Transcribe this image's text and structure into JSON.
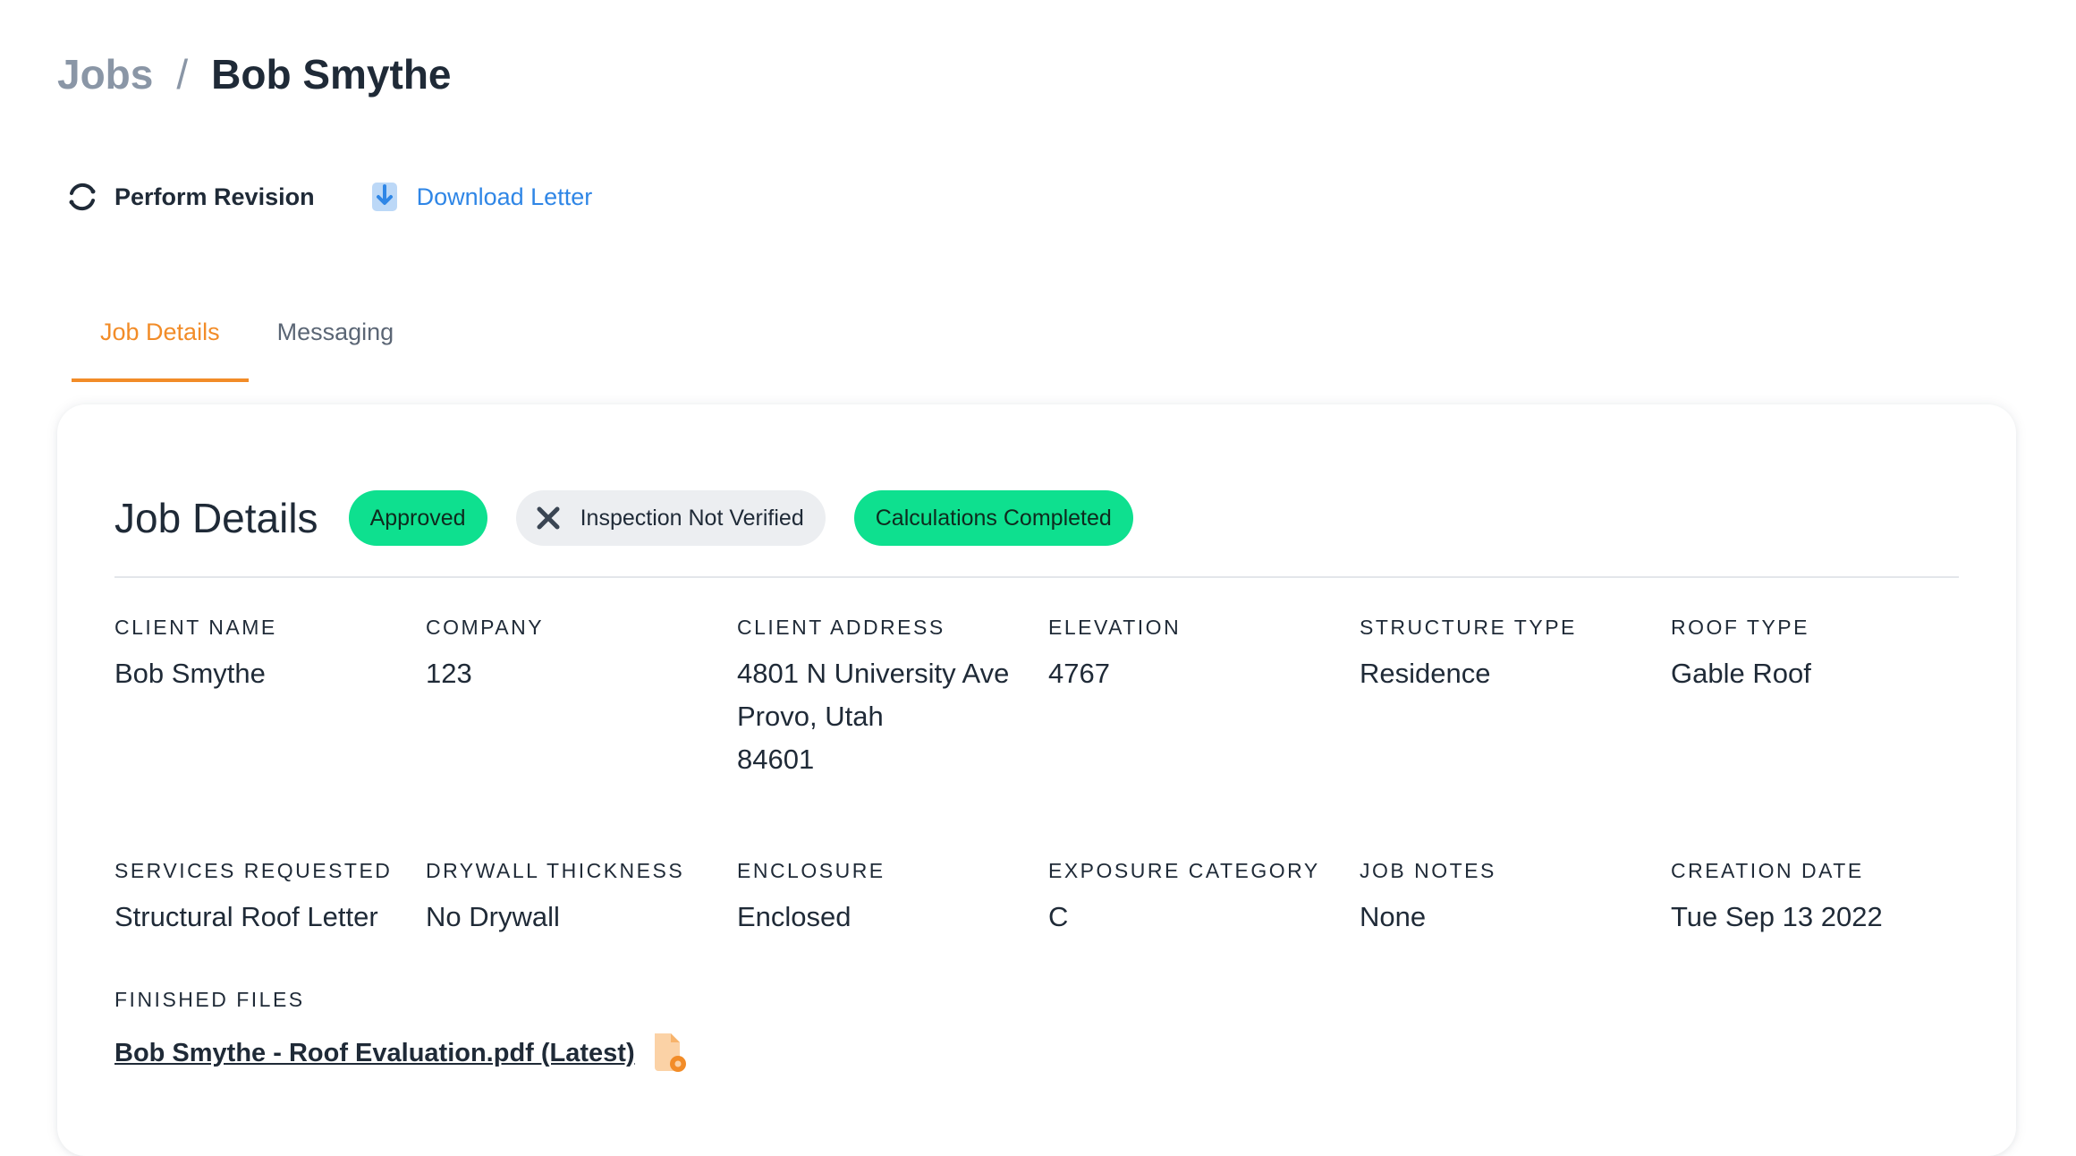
{
  "breadcrumb": {
    "parent": "Jobs",
    "separator": "/",
    "current": "Bob Smythe"
  },
  "toolbar": {
    "revision": {
      "label": "Perform Revision",
      "icon": "refresh-icon"
    },
    "download": {
      "label": "Download Letter",
      "icon": "download-icon"
    }
  },
  "tabs": [
    {
      "label": "Job Details",
      "active": true
    },
    {
      "label": "Messaging",
      "active": false
    }
  ],
  "card": {
    "title": "Job Details",
    "badges": [
      {
        "label": "Approved",
        "style": "green"
      },
      {
        "label": "Inspection Not Verified",
        "style": "gray",
        "icon": "x-icon"
      },
      {
        "label": "Calculations Completed",
        "style": "green"
      }
    ],
    "fields_row1": [
      {
        "label": "Client Name",
        "value": "Bob Smythe"
      },
      {
        "label": "Company",
        "value": "123"
      },
      {
        "label": "Client Address",
        "lines": [
          "4801 N University Ave",
          "Provo, Utah",
          "84601"
        ]
      },
      {
        "label": "Elevation",
        "value": "4767"
      },
      {
        "label": "Structure Type",
        "value": "Residence"
      },
      {
        "label": "Roof Type",
        "value": "Gable Roof"
      }
    ],
    "fields_row2": [
      {
        "label": "Services Requested",
        "value": "Structural Roof Letter"
      },
      {
        "label": "Drywall Thickness",
        "value": "No Drywall"
      },
      {
        "label": "Enclosure",
        "value": "Enclosed"
      },
      {
        "label": "Exposure Category",
        "value": "C"
      },
      {
        "label": "Job Notes",
        "value": "None"
      },
      {
        "label": "Creation Date",
        "value": "Tue Sep 13 2022"
      }
    ],
    "finished_files": {
      "label": "Finished Files",
      "files": [
        {
          "name": "Bob Smythe - Roof Evaluation.pdf (Latest)",
          "icon": "pdf-file-icon"
        }
      ]
    }
  },
  "colors": {
    "accent": "#f28c28",
    "link": "#2f86e6",
    "badge_green": "#0ee08f",
    "badge_gray": "#eceef1",
    "muted": "#8a96a6"
  }
}
